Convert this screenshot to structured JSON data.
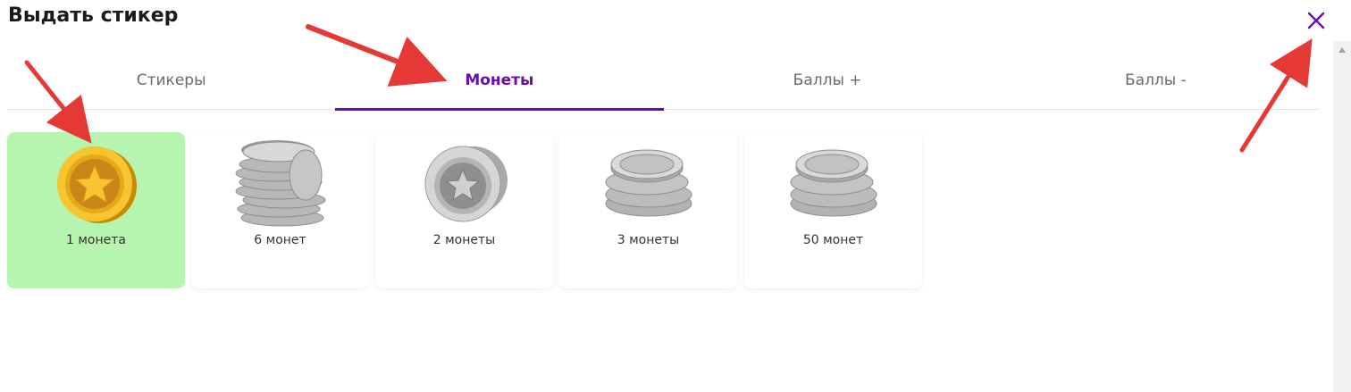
{
  "dialog": {
    "title": "Выдать стикер"
  },
  "icons": {
    "close": "close-icon",
    "scroll_up": "chevron-up-icon"
  },
  "colors": {
    "accent": "#6a0dad",
    "selected_card": "#b5f5b0",
    "annotation_arrow": "#e53935"
  },
  "tabs": [
    {
      "label": "Стикеры",
      "active": false
    },
    {
      "label": "Монеты",
      "active": true
    },
    {
      "label": "Баллы +",
      "active": false
    },
    {
      "label": "Баллы -",
      "active": false
    }
  ],
  "coins": [
    {
      "label": "1 монета",
      "icon": "gold-coin-star-icon",
      "selected": true
    },
    {
      "label": "6 монет",
      "icon": "silver-coin-stack-tall-icon",
      "selected": false
    },
    {
      "label": "2 монеты",
      "icon": "silver-coin-star-icon",
      "selected": false
    },
    {
      "label": "3 монеты",
      "icon": "silver-coin-stack-icon",
      "selected": false
    },
    {
      "label": "50 монет",
      "icon": "silver-coin-stack-icon",
      "selected": false
    }
  ]
}
